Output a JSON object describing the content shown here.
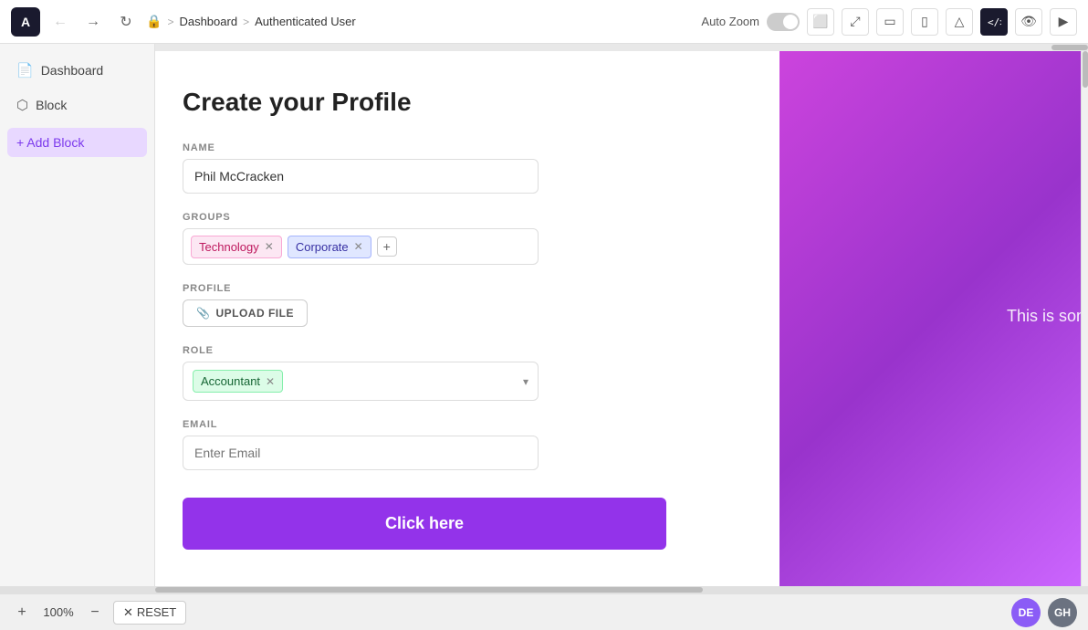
{
  "toolbar": {
    "logo_letter": "A",
    "nav": {
      "back_label": "←",
      "forward_label": "→",
      "refresh_label": "↻"
    },
    "breadcrumb": {
      "lock_icon": "🔒",
      "sep1": ">",
      "item1": "Dashboard",
      "sep2": ">",
      "item2": "Authenticated User"
    },
    "auto_zoom_label": "Auto Zoom",
    "icons": {
      "desktop": "⬜",
      "fullscreen": "⤢",
      "tablet": "▭",
      "mobile": "▯",
      "warning": "△",
      "code": "{}",
      "eye": "👁",
      "play": "▶"
    }
  },
  "sidebar": {
    "items": [
      {
        "icon": "📄",
        "label": "Dashboard"
      },
      {
        "icon": "⬡",
        "label": "Block"
      }
    ],
    "add_block_label": "+ Add Block"
  },
  "form": {
    "title": "Create your Profile",
    "name_label": "NAME",
    "name_value": "Phil McCracken",
    "name_placeholder": "Phil McCracken",
    "groups_label": "GROUPS",
    "groups": [
      {
        "id": "technology",
        "label": "Technology",
        "class": "tag-technology"
      },
      {
        "id": "corporate",
        "label": "Corporate",
        "class": "tag-corporate"
      }
    ],
    "profile_label": "PROFILE",
    "upload_label": "UPLOAD FILE",
    "role_label": "ROLE",
    "role_value": "Accountant",
    "email_label": "EMAIL",
    "email_placeholder": "Enter Email",
    "submit_label": "Click here"
  },
  "canvas_right": {
    "text": "This is som"
  },
  "bottom_bar": {
    "zoom_in": "+",
    "zoom_level": "100%",
    "zoom_out": "−",
    "reset_label": "RESET",
    "avatar1_initials": "DE",
    "avatar1_color": "#8b5cf6",
    "avatar2_initials": "GH",
    "avatar2_color": "#6b7280"
  }
}
